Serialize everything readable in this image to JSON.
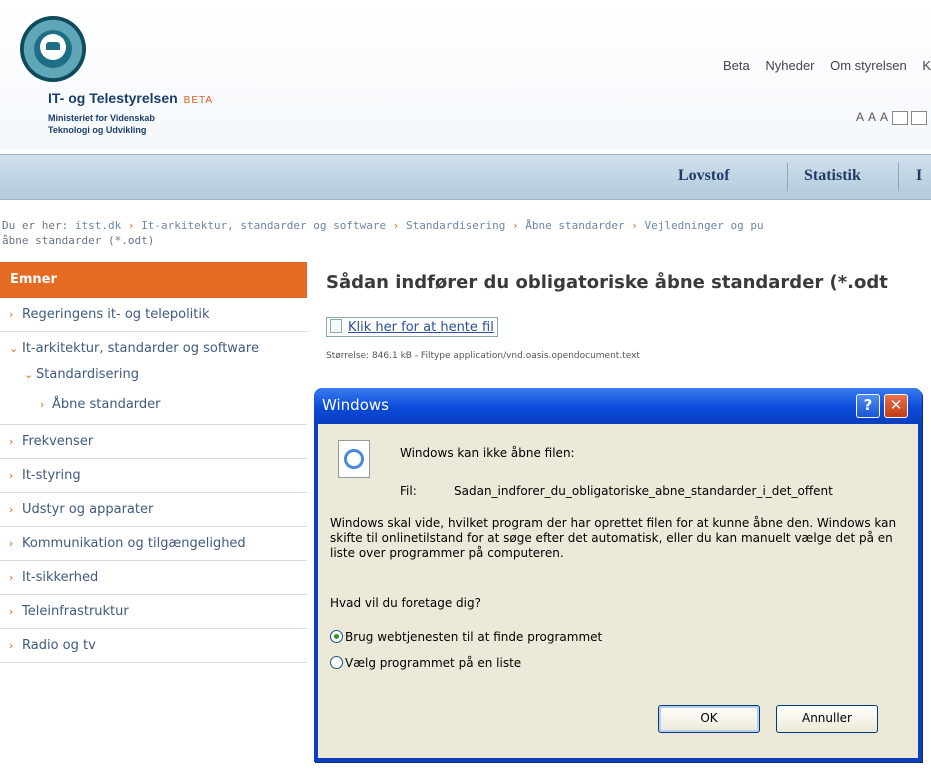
{
  "header": {
    "org_name": "IT- og Telestyrelsen",
    "org_badge": "BETA",
    "org_sub_line1": "Ministeriet for Videnskab",
    "org_sub_line2": "Teknologi og Udvikling",
    "top_links": [
      "Beta",
      "Nyheder",
      "Om styrelsen",
      "K"
    ],
    "font_size_control": "A A A"
  },
  "nav": {
    "items": [
      "Lovstof",
      "Statistik",
      "I"
    ]
  },
  "breadcrumb": {
    "prefix": "Du er her:",
    "items": [
      "itst.dk",
      "It-arkitektur, standarder og software",
      "Standardisering",
      "Åbne standarder",
      "Vejledninger og pu"
    ],
    "line2": "åbne standarder (*.odt)"
  },
  "sidebar": {
    "header": "Emner",
    "items": [
      {
        "label": "Regeringens it- og telepolitik",
        "level": 0
      },
      {
        "label": "It-arkitektur, standarder og software",
        "level": 0
      },
      {
        "label": "Standardisering",
        "level": 1
      },
      {
        "label": "Åbne standarder",
        "level": 2
      },
      {
        "label": "Frekvenser",
        "level": 0
      },
      {
        "label": "It-styring",
        "level": 0
      },
      {
        "label": "Udstyr og apparater",
        "level": 0
      },
      {
        "label": "Kommunikation og tilgængelighed",
        "level": 0
      },
      {
        "label": "It-sikkerhed",
        "level": 0
      },
      {
        "label": "Teleinfrastruktur",
        "level": 0
      },
      {
        "label": "Radio og tv",
        "level": 0
      }
    ]
  },
  "content": {
    "title": "Sådan indfører du obligatoriske åbne standarder (*.odt",
    "download_link": "Klik her for at hente fil",
    "file_meta": "Størrelse: 846.1 kB - Filtype application/vnd.oasis.opendocument.text"
  },
  "dialog": {
    "title": "Windows",
    "help_btn": "?",
    "close_btn": "✕",
    "cannot_open": "Windows kan ikke åbne filen:",
    "file_label": "Fil:",
    "file_name": "Sadan_indforer_du_obligatoriske_abne_standarder_i_det_offent",
    "explanation": "Windows skal vide, hvilket program der har oprettet filen for at kunne åbne den. Windows kan skifte til onlinetilstand for at søge efter det automatisk, eller du kan manuelt vælge det på en liste over programmer på computeren.",
    "question": "Hvad vil du foretage dig?",
    "option_web": "Brug webtjenesten til at finde programmet",
    "option_list": "Vælg programmet på en liste",
    "ok": "OK",
    "cancel": "Annuller"
  }
}
